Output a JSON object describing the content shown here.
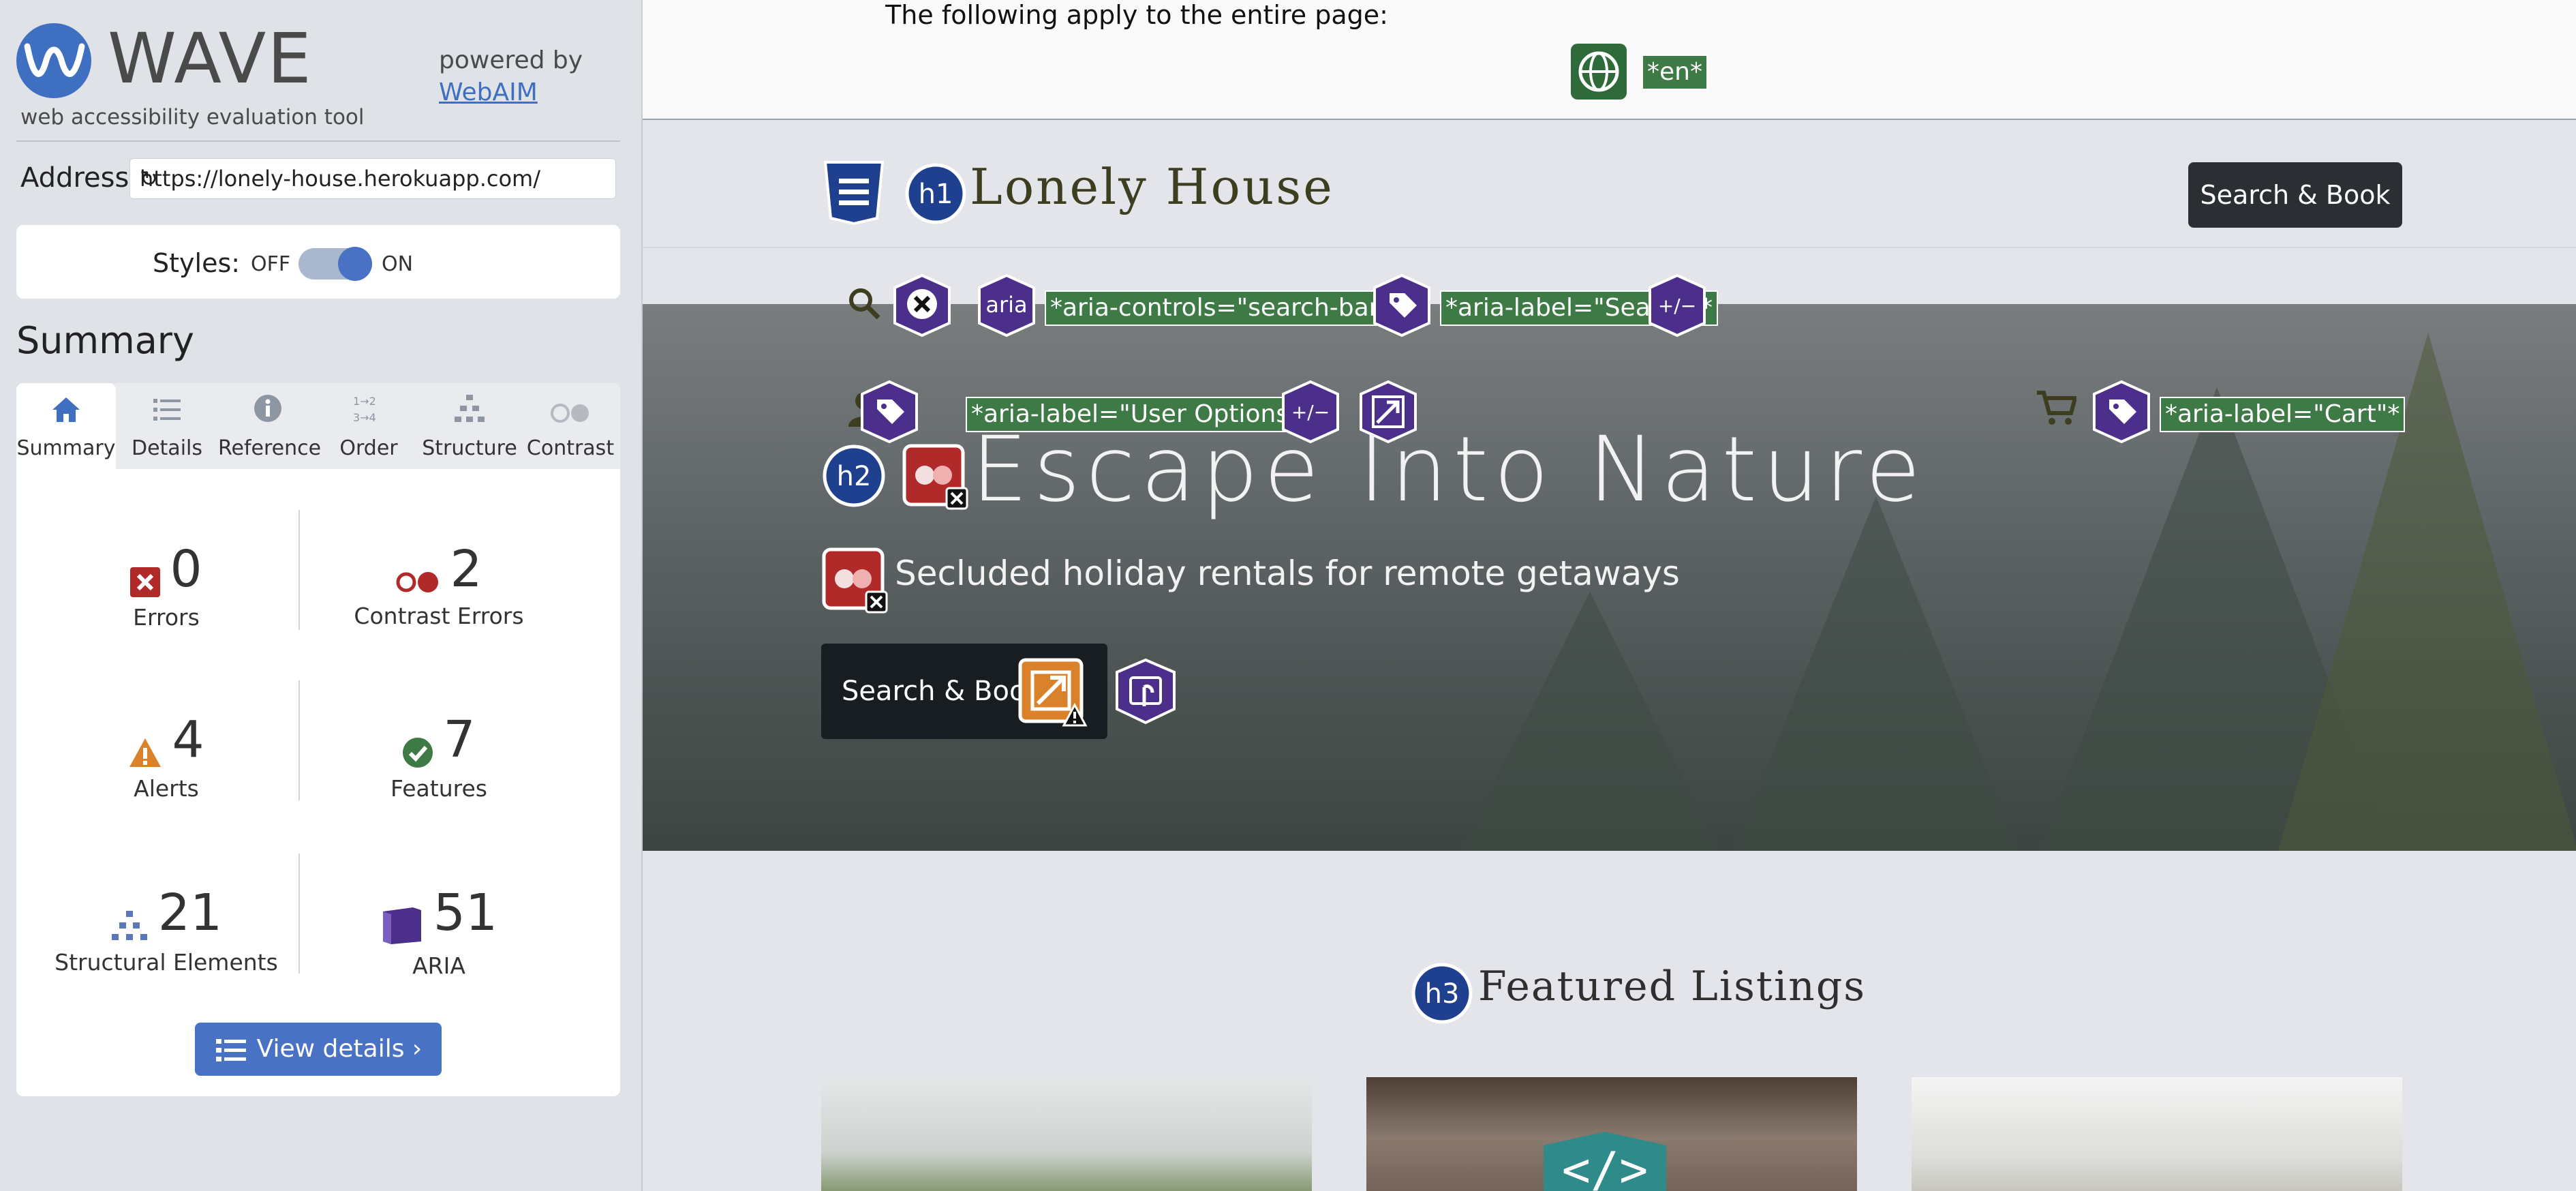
{
  "wave": {
    "title": "WAVE",
    "subtitle": "web accessibility evaluation tool",
    "powered_by": "powered by",
    "webaim_link": "WebAIM",
    "address_label": "Address:",
    "address_value": "https://lonely-house.herokuapp.com/",
    "styles_label": "Styles:",
    "styles_off": "OFF",
    "styles_on": "ON",
    "styles_enabled": true,
    "summary_heading": "Summary",
    "tabs": [
      {
        "label": "Summary",
        "icon": "home-icon",
        "active": true
      },
      {
        "label": "Details",
        "icon": "list-icon"
      },
      {
        "label": "Reference",
        "icon": "info-icon"
      },
      {
        "label": "Order",
        "icon": "order-icon"
      },
      {
        "label": "Structure",
        "icon": "structure-icon"
      },
      {
        "label": "Contrast",
        "icon": "contrast-icon"
      }
    ],
    "stats": {
      "errors": {
        "value": "0",
        "label": "Errors"
      },
      "contrast_errors": {
        "value": "2",
        "label": "Contrast Errors"
      },
      "alerts": {
        "value": "4",
        "label": "Alerts"
      },
      "features": {
        "value": "7",
        "label": "Features"
      },
      "structural": {
        "value": "21",
        "label": "Structural Elements"
      },
      "aria": {
        "value": "51",
        "label": "ARIA"
      }
    },
    "view_details_label": "View details ›"
  },
  "page": {
    "applies_text": "The following apply to the entire page:",
    "lang_tag": "*en*",
    "site_title": "Lonely House",
    "header_button": "Search & Book",
    "badges": {
      "h1": "h1",
      "h2": "h2",
      "h3": "h3",
      "aria": "aria",
      "expand": "+/−"
    },
    "aria_controls_search": "*aria-controls=\"search-bar\"*",
    "aria_label_search": "*aria-label=\"Search\"*",
    "aria_label_user": "*aria-label=\"User Options\"*",
    "aria_label_cart": "*aria-label=\"Cart\"*",
    "hero_title": "Escape Into Nature",
    "hero_subtitle": "Secluded holiday rentals for remote getaways",
    "hero_button": "Search & Book",
    "featured_heading": "Featured Listings"
  },
  "colors": {
    "wave_blue": "#3f6fc0",
    "aria_purple": "#4b2f8a",
    "contrast_red": "#b02a2a",
    "alert_orange": "#d9822b",
    "feature_green": "#3d7a46",
    "structure_navy": "#1f3f8f"
  }
}
